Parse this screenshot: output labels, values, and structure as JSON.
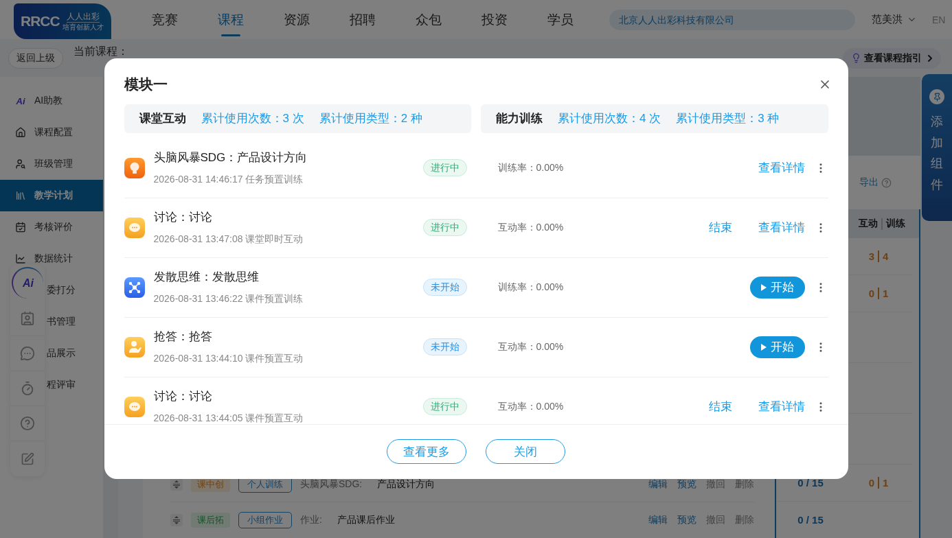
{
  "header": {
    "logo": {
      "mark": "RRCC",
      "name": "人人出彩",
      "slogan": "培育创新人才"
    },
    "nav": [
      {
        "label": "竞赛",
        "selected": false
      },
      {
        "label": "课程",
        "selected": true
      },
      {
        "label": "资源",
        "selected": false
      },
      {
        "label": "招聘",
        "selected": false
      },
      {
        "label": "众包",
        "selected": false
      },
      {
        "label": "投资",
        "selected": false
      },
      {
        "label": "学员",
        "selected": false
      }
    ],
    "company": "北京人人出彩科技有限公司",
    "user": "范美洪",
    "language": {
      "label": "EN",
      "selected": false
    }
  },
  "subbar": {
    "back": "返回上级",
    "course": "当前课程：",
    "guide": "查看课程指引"
  },
  "sidebar": {
    "items": [
      {
        "label": "AI助教",
        "kind": "ai",
        "badge": "Ai",
        "selected": false
      },
      {
        "label": "课程配置",
        "kind": "house",
        "selected": false
      },
      {
        "label": "班级管理",
        "kind": "class",
        "selected": false
      },
      {
        "label": "教学计划",
        "kind": "plan",
        "selected": true
      },
      {
        "label": "考核评价",
        "kind": "exam",
        "selected": false
      },
      {
        "label": "数据统计",
        "kind": "stats",
        "selected": false
      },
      {
        "label": "委打分",
        "kind": "hidden",
        "selected": false
      },
      {
        "label": "书管理",
        "kind": "hidden",
        "selected": false
      },
      {
        "label": "品展示",
        "kind": "hidden",
        "selected": false
      },
      {
        "label": "程评审",
        "kind": "hidden",
        "selected": false
      }
    ]
  },
  "floating_tools": {
    "ai_label": "Ai"
  },
  "main": {
    "export": "导出",
    "stats_header": {
      "interaction": "互动",
      "training": "训练"
    },
    "stats_rows": [
      {
        "kind": "values",
        "interaction": "3",
        "training": "4"
      },
      {
        "kind": "values",
        "interaction": "0",
        "training": "1"
      },
      {
        "kind": "blank"
      },
      {
        "kind": "blank"
      },
      {
        "kind": "blank"
      },
      {
        "kind": "values",
        "progress": "0 / 15",
        "interaction": "0",
        "training": "1"
      },
      {
        "kind": "values",
        "progress": "0 / 15"
      }
    ],
    "lessons": [
      {
        "stage": {
          "label": "课中创",
          "kind": "in_class"
        },
        "type": "个人训练",
        "prefix": "头脑风暴SDG:",
        "title": "产品设计方向",
        "actions": [
          {
            "label": "编辑",
            "kind": "primary"
          },
          {
            "label": "预览",
            "kind": "primary"
          },
          {
            "label": "撤回",
            "kind": "muted"
          },
          {
            "label": "删除",
            "kind": "muted"
          }
        ]
      },
      {
        "stage": {
          "label": "课后拓",
          "kind": "after_class"
        },
        "type": "小组作业",
        "prefix": "作业:",
        "title": "产品课后作业",
        "actions": [
          {
            "label": "编辑",
            "kind": "primary"
          },
          {
            "label": "预览",
            "kind": "primary"
          },
          {
            "label": "撤回",
            "kind": "muted"
          },
          {
            "label": "删除",
            "kind": "muted"
          }
        ]
      }
    ]
  },
  "add_widget": "添加组件",
  "modal": {
    "title": "模块一",
    "summaries": [
      {
        "name": "课堂互动",
        "count": "累计使用次数：3 次",
        "types": "累计使用类型：2 种"
      },
      {
        "name": "能力训练",
        "count": "累计使用次数：4 次",
        "types": "累计使用类型：3 种"
      }
    ],
    "rows": [
      {
        "kind": "bulb",
        "title": "头脑风暴SDG：产品设计方向",
        "meta": "2026-08-31 14:46:17 任务预置训练",
        "status": {
          "label": "进行中",
          "kind": "active"
        },
        "rate": "训练率：0.00%",
        "actions": [
          {
            "label": "查看详情",
            "kind": "link"
          }
        ]
      },
      {
        "kind": "chat",
        "title": "讨论：讨论",
        "meta": "2026-08-31 13:47:08 课堂即时互动",
        "status": {
          "label": "进行中",
          "kind": "active"
        },
        "rate": "互动率：0.00%",
        "actions": [
          {
            "label": "结束",
            "kind": "link"
          },
          {
            "label": "查看详情",
            "kind": "link"
          }
        ]
      },
      {
        "kind": "network",
        "title": "发散思维：发散思维",
        "meta": "2026-08-31 13:46:22 课件预置训练",
        "status": {
          "label": "未开始",
          "kind": "pending"
        },
        "rate": "训练率：0.00%",
        "actions": [
          {
            "label": "开始",
            "kind": "start"
          }
        ]
      },
      {
        "kind": "hand",
        "title": "抢答：抢答",
        "meta": "2026-08-31 13:44:10 课件预置互动",
        "status": {
          "label": "未开始",
          "kind": "pending"
        },
        "rate": "互动率：0.00%",
        "actions": [
          {
            "label": "开始",
            "kind": "start"
          }
        ]
      },
      {
        "kind": "chat",
        "title": "讨论：讨论",
        "meta": "2026-08-31 13:44:05 课件预置互动",
        "status": {
          "label": "进行中",
          "kind": "active"
        },
        "rate": "互动率：0.00%",
        "actions": [
          {
            "label": "结束",
            "kind": "link"
          },
          {
            "label": "查看详情",
            "kind": "link"
          }
        ]
      }
    ],
    "buttons": [
      "查看更多",
      "关闭"
    ]
  }
}
